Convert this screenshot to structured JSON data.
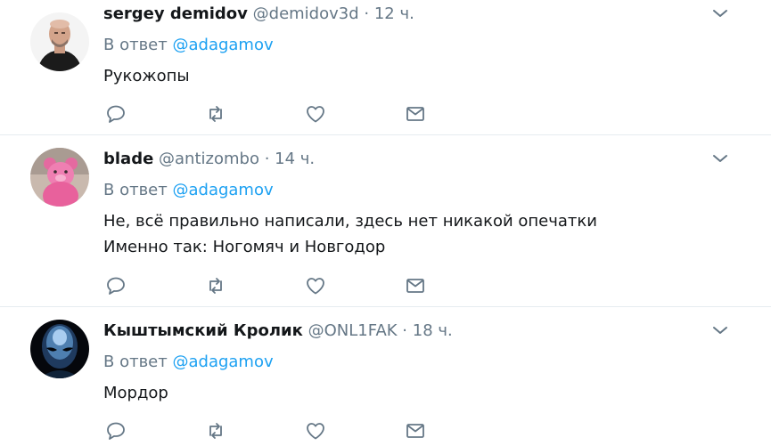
{
  "tweets": [
    {
      "name": "sergey demidov",
      "handle": "@demidov3d",
      "separator": "·",
      "time": "12 ч.",
      "reply_prefix": "В ответ",
      "reply_to": "@adagamov",
      "lines": [
        "Рукожопы"
      ]
    },
    {
      "name": "blade",
      "handle": "@antizombo",
      "separator": "·",
      "time": "14 ч.",
      "reply_prefix": "В ответ",
      "reply_to": "@adagamov",
      "lines": [
        "Не, всё правильно написали, здесь нет никакой опечатки",
        "Именно так: Ногомяч и Новгодор"
      ]
    },
    {
      "name": "Кыштымский Кролик",
      "handle": "@ONL1FAK",
      "separator": "·",
      "time": "18 ч.",
      "reply_prefix": "В ответ",
      "reply_to": "@adagamov",
      "lines": [
        "Мордор"
      ]
    }
  ],
  "colors": {
    "name": "#14171a",
    "meta": "#657786",
    "mention": "#1da1f2",
    "divider": "#e6ecf0",
    "icon": "#657786"
  },
  "icons": {
    "reply": "reply-icon",
    "retweet": "retweet-icon",
    "like": "heart-icon",
    "dm": "envelope-icon",
    "menu": "chevron-down-icon"
  }
}
